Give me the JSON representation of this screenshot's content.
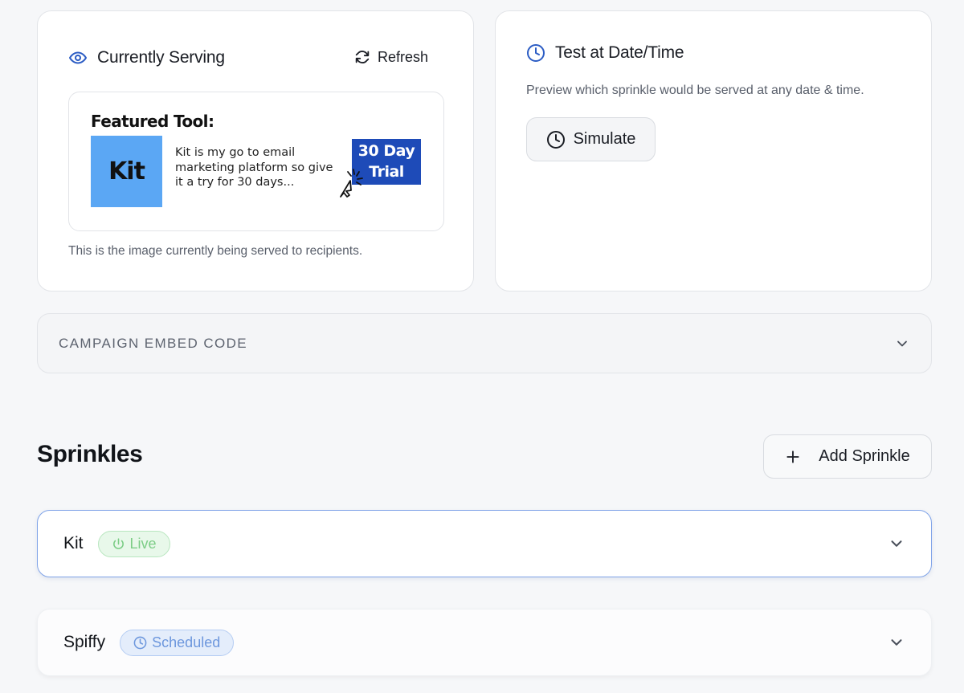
{
  "serving": {
    "title": "Currently Serving",
    "refresh_label": "Refresh",
    "caption": "This is the image currently being served to recipients.",
    "preview": {
      "heading": "Featured Tool:",
      "logo_text": "Kit",
      "body": "Kit is my go to email marketing platform so give it a try for 30 days...",
      "badge": "30 Day Trial"
    }
  },
  "test": {
    "title": "Test at Date/Time",
    "description": "Preview which sprinkle would be served at any date & time.",
    "simulate_label": "Simulate"
  },
  "embed": {
    "label": "CAMPAIGN EMBED CODE"
  },
  "sprinkles": {
    "title": "Sprinkles",
    "add_label": "Add Sprinkle",
    "items": [
      {
        "name": "Kit",
        "status": "Live"
      },
      {
        "name": "Spiffy",
        "status": "Scheduled"
      }
    ]
  },
  "colors": {
    "accent": "#2b5cc4",
    "live": "#7ccd86",
    "scheduled": "#6d97dd",
    "trial_badge": "#1e4bb8",
    "kit_logo_bg": "#5ba7f4"
  }
}
